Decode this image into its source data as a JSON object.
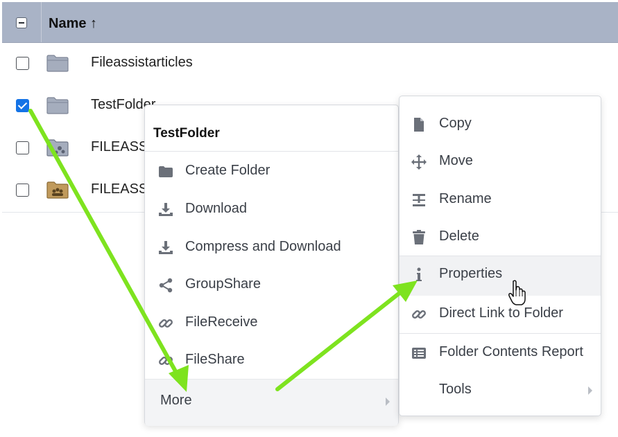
{
  "table": {
    "header": {
      "name_label": "Name ↑"
    },
    "rows": [
      {
        "name": "Fileassistarticles",
        "checked": false,
        "folder": "plain"
      },
      {
        "name": "TestFolder",
        "checked": true,
        "folder": "plain"
      },
      {
        "name": "FILEASSI",
        "checked": false,
        "folder": "shared"
      },
      {
        "name": "FILEASSI",
        "checked": false,
        "folder": "group"
      }
    ]
  },
  "context_menu": {
    "title": "TestFolder",
    "items": [
      {
        "label": "Create Folder",
        "icon": "folder-icon"
      },
      {
        "label": "Download",
        "icon": "download-icon"
      },
      {
        "label": "Compress and Download",
        "icon": "compress-download-icon"
      },
      {
        "label": "GroupShare",
        "icon": "share-icon"
      },
      {
        "label": "FileReceive",
        "icon": "link-icon"
      },
      {
        "label": "FileShare",
        "icon": "link-icon"
      }
    ],
    "more_label": "More"
  },
  "submenu": {
    "items": [
      {
        "label": "Copy",
        "icon": "file-icon"
      },
      {
        "label": "Move",
        "icon": "move-icon"
      },
      {
        "label": "Rename",
        "icon": "rename-icon"
      },
      {
        "label": "Delete",
        "icon": "trash-icon"
      },
      {
        "label": "Properties",
        "icon": "info-icon",
        "highlighted": true
      },
      {
        "label": "Direct Link to Folder",
        "icon": "link-icon"
      },
      {
        "label": "Folder Contents Report",
        "icon": "list-icon"
      }
    ],
    "tools_label": "Tools"
  },
  "colors": {
    "header_bg": "#a9b3c6",
    "checkbox_checked": "#1473e6",
    "annotation_arrow": "#7ee31f",
    "menu_icon": "#6b7079"
  }
}
